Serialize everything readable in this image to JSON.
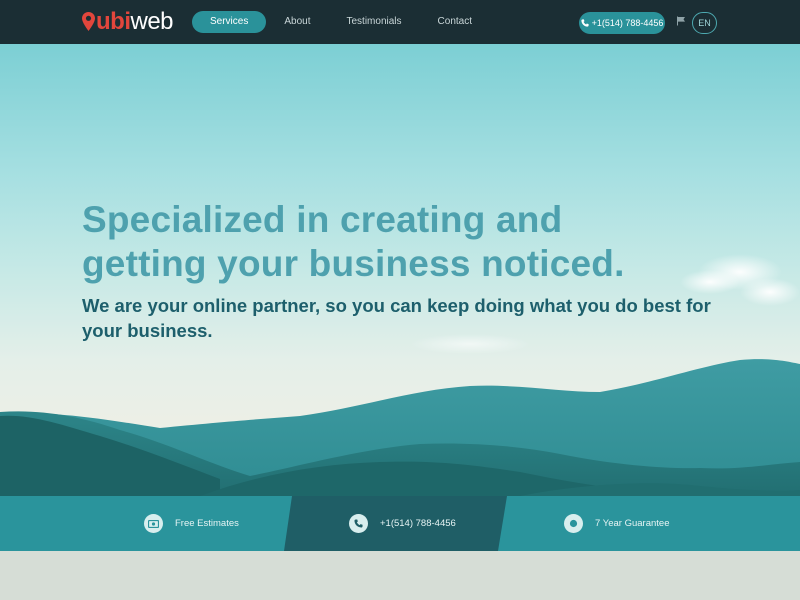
{
  "brand": {
    "logo_part1": "ubi",
    "logo_part2": "web"
  },
  "nav": {
    "items": [
      {
        "label": "Services",
        "active": true
      },
      {
        "label": "About"
      },
      {
        "label": "Testimonials"
      },
      {
        "label": "Contact"
      }
    ],
    "phone_label": "+1(514) 788-4456",
    "language": "EN"
  },
  "hero": {
    "headline_line1": "Specialized in creating and",
    "headline_line2": "getting your business noticed.",
    "subheadline": "We are your online partner, so you can keep doing what you do best for your business."
  },
  "features": [
    {
      "label": "Free Estimates",
      "icon": "money-icon"
    },
    {
      "label": "+1(514) 788-4456",
      "icon": "phone-icon"
    },
    {
      "label": "7 Year Guarantee",
      "icon": "badge-icon"
    }
  ],
  "colors": {
    "nav_bg": "#1b2e34",
    "accent": "#2a929a",
    "logo_red": "#e2463c",
    "headline": "#4ea1ae",
    "subheadline": "#1d5f6c",
    "feature_bar": "#2a949c",
    "feature_bar_dark": "#1f5e66"
  }
}
